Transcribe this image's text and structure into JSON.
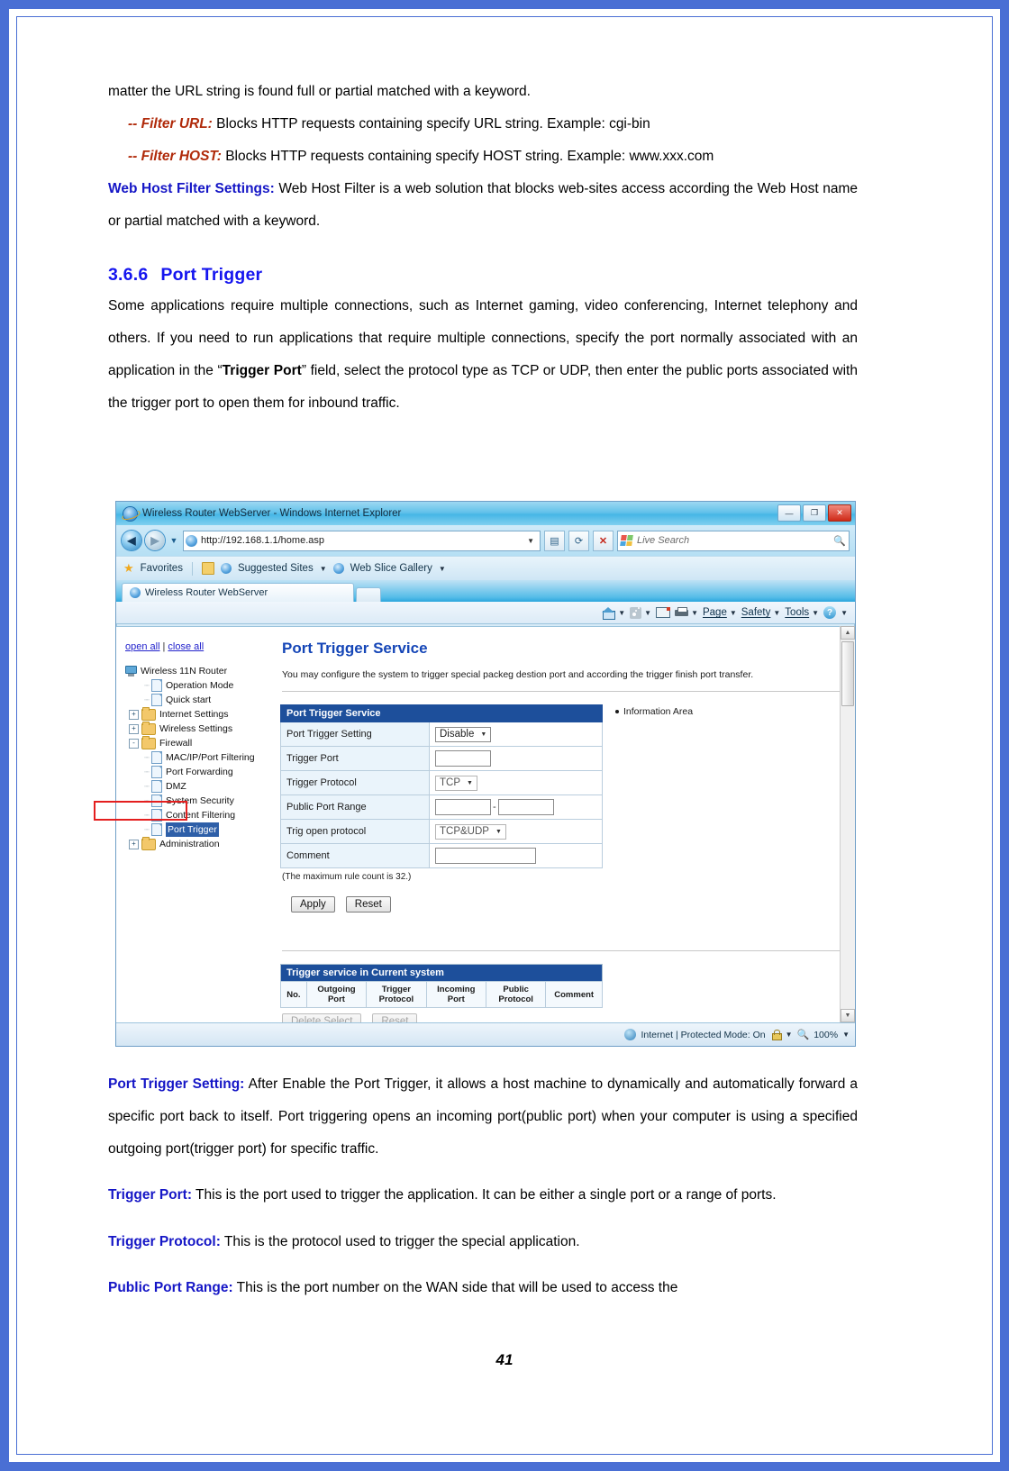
{
  "document": {
    "intro_line": "matter the URL string is found full or partial matched with a keyword.",
    "filter_url_label": "-- Filter URL:",
    "filter_url_text": " Blocks HTTP requests containing specify URL string. Example: cgi-bin",
    "filter_host_label": "--  Filter  HOST:",
    "filter_host_text": "  Blocks   HTTP   requests   containing   specify   HOST   string.   Example: www.xxx.com",
    "web_host_label": "Web Host Filter Settings:",
    "web_host_text": " Web Host Filter is a web solution that blocks web-sites access according the Web Host name or partial matched with a keyword.",
    "section_number": "3.6.6",
    "section_title": "Port Trigger",
    "body_1": "Some applications require multiple connections, such as Internet gaming, video conferencing, Internet telephony and others. If you need to run applications that require multiple connections, specify the port normally associated with an application in the “",
    "body_1_bold": "Trigger Port",
    "body_1_cont": "” field, select the protocol type as TCP or UDP, then enter the public ports associated with the trigger port to open them for inbound traffic.",
    "after": [
      {
        "label": "Port Trigger Setting:",
        "text": " After Enable the Port Trigger, it allows a host machine to dynamically and automatically forward a specific port back to itself. Port triggering opens an incoming port(public port) when your computer is using a specified outgoing port(trigger port) for specific traffic."
      },
      {
        "label": "Trigger Port:",
        "text": " This is the port used to trigger the application. It can be either a single port or a range of ports."
      },
      {
        "label": "Trigger Protocol:",
        "text": " This is the protocol used to trigger the special application."
      },
      {
        "label": "Public Port Range:",
        "text": " This is the port number on the WAN side that will be used to access the"
      }
    ],
    "page_number": "41"
  },
  "browser": {
    "title": "Wireless Router WebServer - Windows Internet Explorer",
    "window_buttons": {
      "minimize": "—",
      "maximize": "❐",
      "close": "✕"
    },
    "address": {
      "url": "http://192.168.1.1/home.asp",
      "dropdown_caret": "▼",
      "refresh_icon": "refresh-icon",
      "stop_icon": "✕"
    },
    "search": {
      "placeholder": "Live Search"
    },
    "favorites_bar": {
      "favorites_label": "Favorites",
      "suggested_sites": "Suggested Sites",
      "web_slice_gallery": "Web Slice Gallery"
    },
    "tab_label": "Wireless Router WebServer",
    "command_bar": {
      "page": "Page",
      "safety": "Safety",
      "tools": "Tools",
      "help": "?"
    },
    "status_bar": {
      "zone": "Internet | Protected Mode: On",
      "zoom": "100%"
    }
  },
  "router_page": {
    "open_all": "open all",
    "close_all": "close all",
    "separator": "|",
    "tree": [
      {
        "label": "Wireless 11N Router",
        "icon": "router-icon",
        "level": 0,
        "expander": "",
        "selected": false
      },
      {
        "label": "Operation Mode",
        "icon": "page-icon",
        "level": 2,
        "expander": "",
        "selected": false
      },
      {
        "label": "Quick start",
        "icon": "page-icon",
        "level": 2,
        "expander": "",
        "selected": false
      },
      {
        "label": "Internet Settings",
        "icon": "folder-icon",
        "level": 1,
        "expander": "+",
        "selected": false
      },
      {
        "label": "Wireless Settings",
        "icon": "folder-icon",
        "level": 1,
        "expander": "+",
        "selected": false
      },
      {
        "label": "Firewall",
        "icon": "folder-icon",
        "level": 1,
        "expander": "-",
        "selected": false
      },
      {
        "label": "MAC/IP/Port Filtering",
        "icon": "page-icon",
        "level": 2,
        "expander": "",
        "selected": false
      },
      {
        "label": "Port Forwarding",
        "icon": "page-icon",
        "level": 2,
        "expander": "",
        "selected": false
      },
      {
        "label": "DMZ",
        "icon": "page-icon",
        "level": 2,
        "expander": "",
        "selected": false
      },
      {
        "label": "System Security",
        "icon": "page-icon",
        "level": 2,
        "expander": "",
        "selected": false
      },
      {
        "label": "Content Filtering",
        "icon": "page-icon",
        "level": 2,
        "expander": "",
        "selected": false
      },
      {
        "label": "Port Trigger",
        "icon": "page-icon",
        "level": 2,
        "expander": "",
        "selected": true
      },
      {
        "label": "Administration",
        "icon": "folder-icon",
        "level": 1,
        "expander": "+",
        "selected": false
      }
    ],
    "title": "Port Trigger Service",
    "description": "You may configure the system to trigger special packeg destion port and according the trigger finish port transfer.",
    "form": {
      "header": "Port Trigger Service",
      "rows": [
        {
          "label": "Port Trigger Setting",
          "type": "select",
          "value": "Disable"
        },
        {
          "label": "Trigger Port",
          "type": "text",
          "value": ""
        },
        {
          "label": "Trigger Protocol",
          "type": "select",
          "value": "TCP"
        },
        {
          "label": "Public Port Range",
          "type": "range",
          "value": "",
          "value2": ""
        },
        {
          "label": "Trig open protocol",
          "type": "select",
          "value": "TCP&UDP"
        },
        {
          "label": "Comment",
          "type": "text-wide",
          "value": ""
        }
      ],
      "note": "(The maximum rule count is 32.)",
      "apply_label": "Apply",
      "reset_label": "Reset"
    },
    "information_area": "Information Area",
    "current_table": {
      "header": "Trigger service in Current system",
      "columns": [
        "No.",
        "Outgoing Port",
        "Trigger Protocol",
        "Incoming Port",
        "Public Protocol",
        "Comment"
      ],
      "rows": [],
      "delete_label": "Delete Select",
      "reset_label": "Reset"
    }
  },
  "colors": {
    "heading_blue": "#1515ef",
    "lead_blue": "#1516c6",
    "accent_red": "#b02a0a",
    "highlight_red": "#e41f1f",
    "table_header_blue": "#1d4f9b",
    "frame_blue": "#4a6fd4"
  }
}
